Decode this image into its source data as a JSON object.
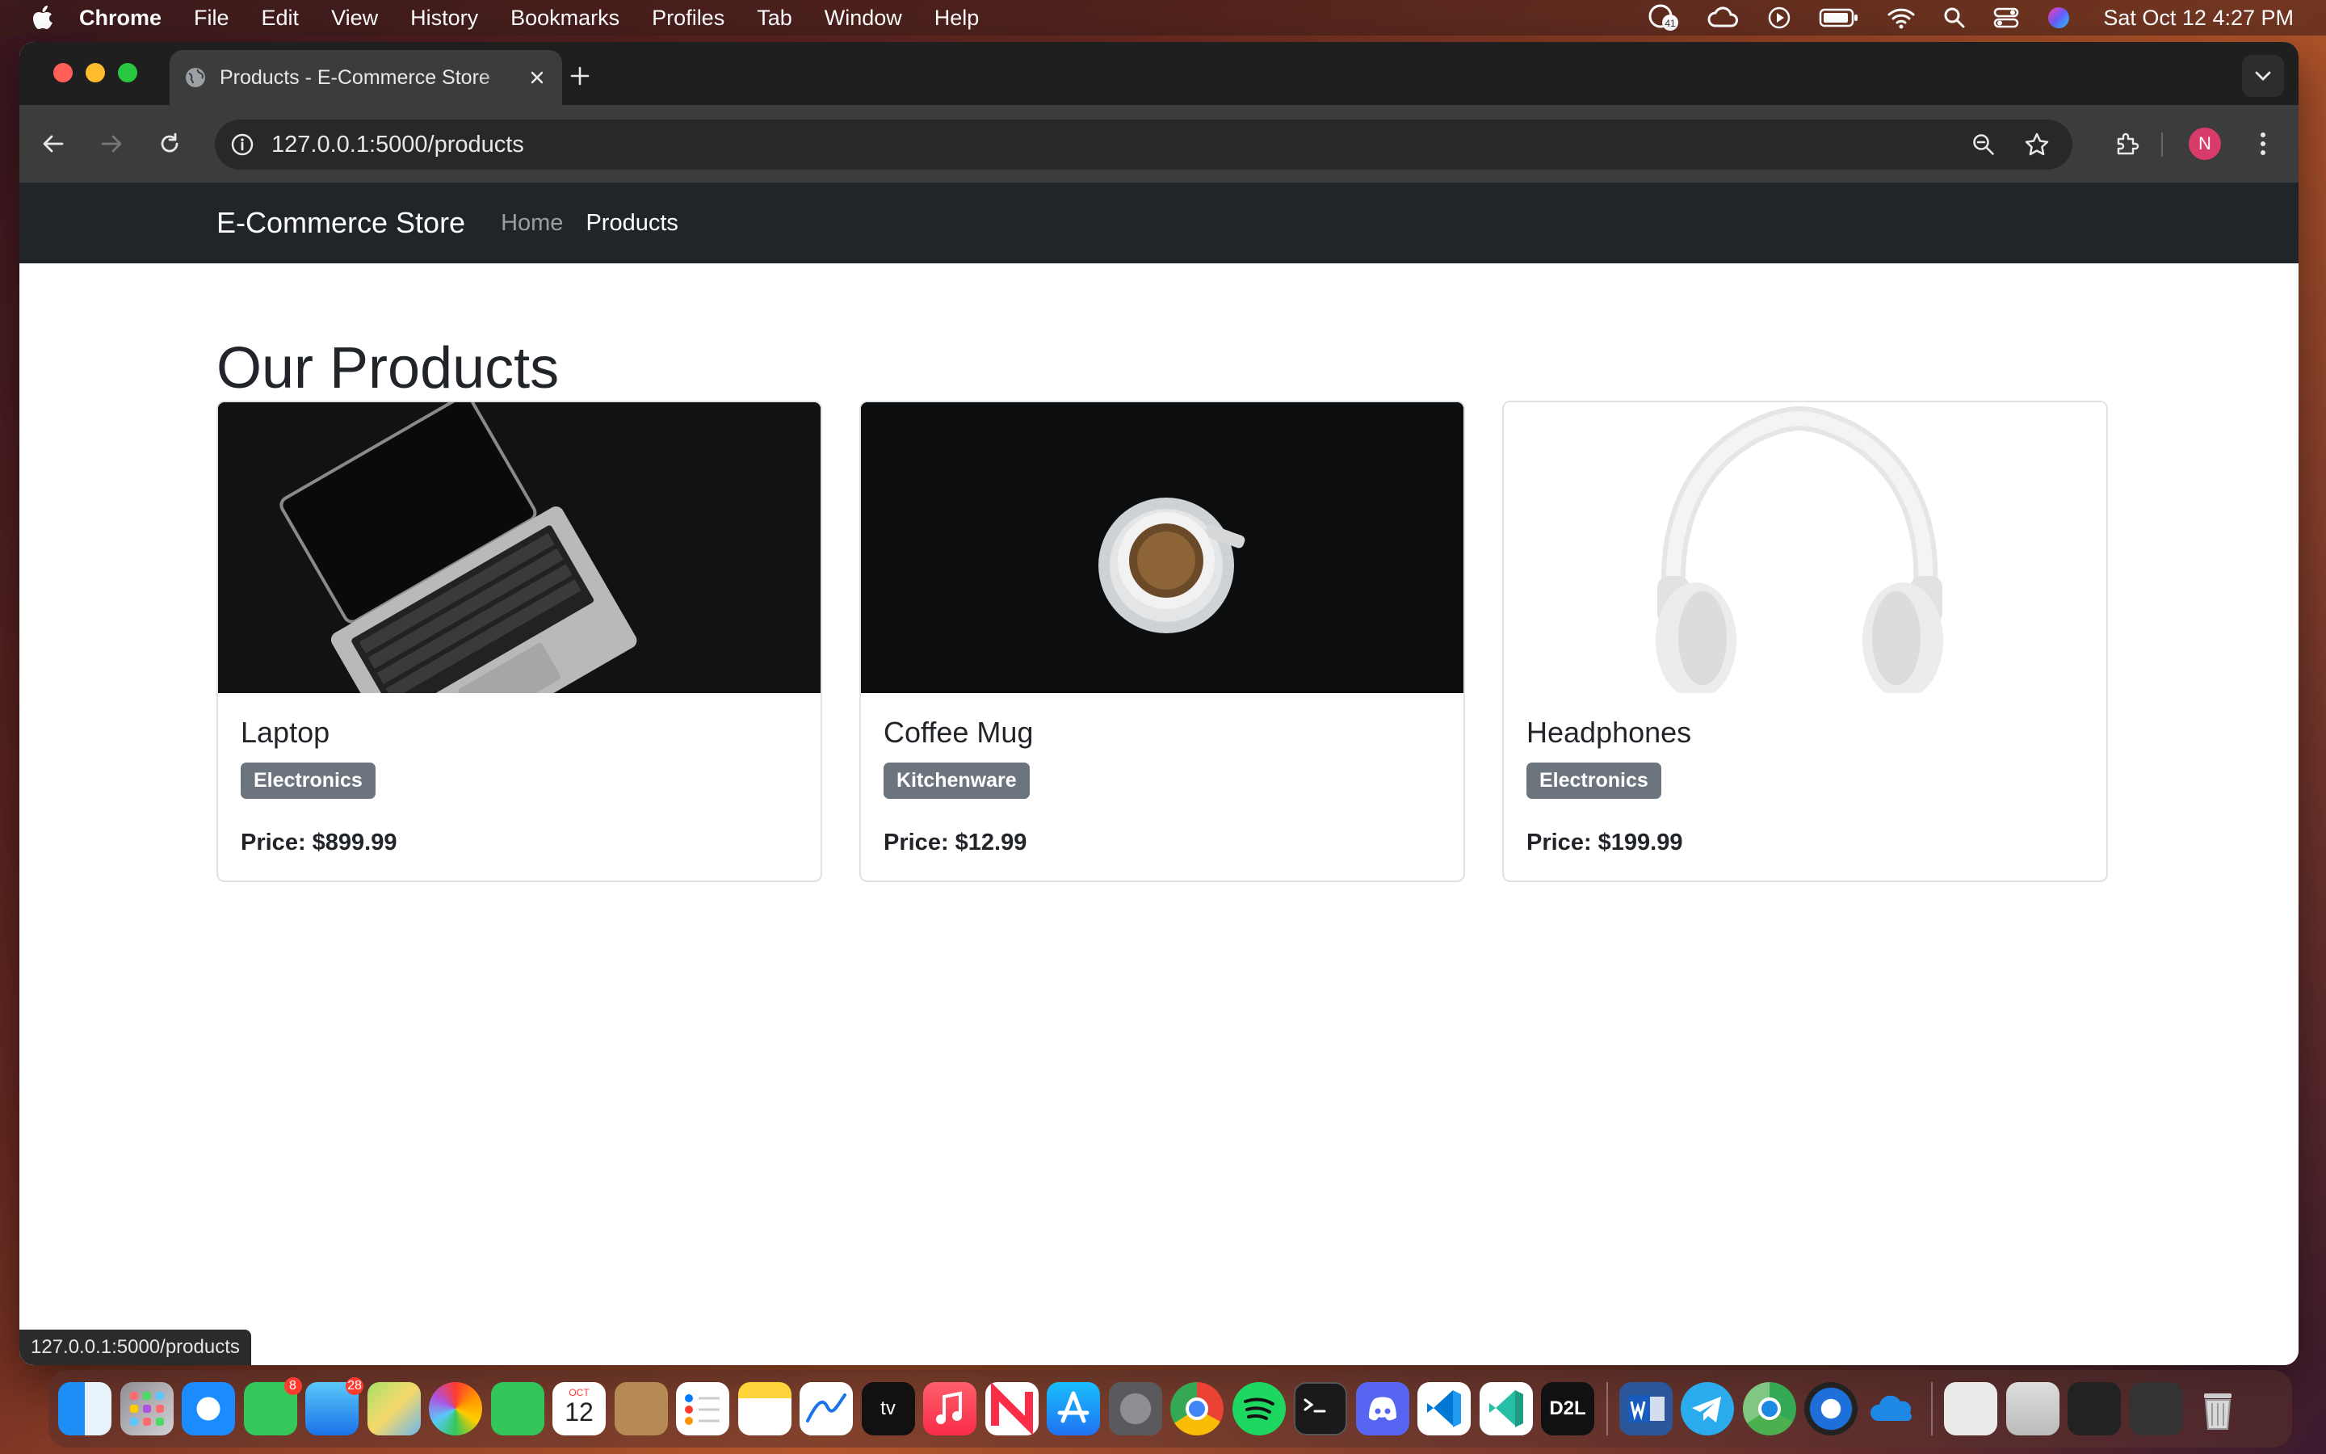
{
  "menubar": {
    "app": "Chrome",
    "items": [
      "File",
      "Edit",
      "View",
      "History",
      "Bookmarks",
      "Profiles",
      "Tab",
      "Window",
      "Help"
    ],
    "status_icons": [
      "notification-icon",
      "cloud-icon",
      "play-icon",
      "battery-icon",
      "wifi-icon",
      "spotlight-icon",
      "control-center-icon",
      "siri-icon"
    ],
    "clock": "Sat Oct 12  4:27 PM",
    "badge": "41"
  },
  "browser": {
    "tab_title": "Products - E-Commerce Store",
    "url": "127.0.0.1:5000/products",
    "profile_initial": "N",
    "status_url": "127.0.0.1:5000/products"
  },
  "site": {
    "brand": "E-Commerce Store",
    "nav": [
      "Home",
      "Products"
    ],
    "heading": "Our Products",
    "products": [
      {
        "name": "Laptop",
        "category": "Electronics",
        "price": "Price: $899.99",
        "image": "laptop-image"
      },
      {
        "name": "Coffee Mug",
        "category": "Kitchenware",
        "price": "Price: $12.99",
        "image": "coffee-image"
      },
      {
        "name": "Headphones",
        "category": "Electronics",
        "price": "Price: $199.99",
        "image": "headphones-image"
      }
    ]
  },
  "dock": {
    "apps": [
      "finder-icon",
      "launchpad-icon",
      "safari-icon",
      "messages-icon",
      "mail-icon",
      "maps-icon",
      "photos-icon",
      "facetime-icon",
      "calendar-icon",
      "contacts-icon",
      "reminders-icon",
      "notes-icon",
      "freeform-icon",
      "tv-icon",
      "music-icon",
      "news-icon",
      "app-store-icon",
      "settings-icon",
      "chrome-icon",
      "spotify-icon",
      "terminal-icon",
      "discord-icon",
      "vscode-icon",
      "vscode-insiders-icon",
      "d2l-icon"
    ],
    "apps2": [
      "word-icon",
      "telegram-icon",
      "chrome-canary-icon",
      "quicktime-icon",
      "onedrive-icon"
    ],
    "recent": [
      "window-thumb-1",
      "window-thumb-2",
      "window-thumb-3",
      "window-thumb-4",
      "trash-icon"
    ],
    "messages_badge": "8",
    "mail_badge": "28",
    "calendar_month": "OCT",
    "calendar_day": "12",
    "tv_label": "tv",
    "d2l_label": "D2L"
  },
  "colors": {
    "navbar": "#212529",
    "badge": "#6c757d",
    "profile": "#d93b6a"
  }
}
